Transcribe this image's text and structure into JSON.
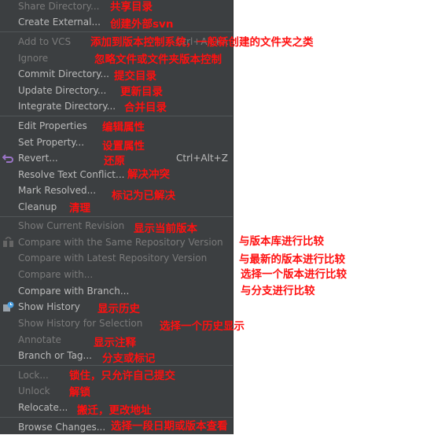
{
  "menu": {
    "items": [
      {
        "label": "Share Directory...",
        "enabled": false
      },
      {
        "label": "Create External...",
        "enabled": true
      },
      {
        "label": "Add to VCS",
        "enabled": false,
        "shortcut": "Ctrl+Alt+A"
      },
      {
        "label": "Ignore",
        "enabled": false
      },
      {
        "label": "Commit Directory...",
        "enabled": true
      },
      {
        "label": "Update Directory...",
        "enabled": true
      },
      {
        "label": "Integrate Directory...",
        "enabled": true
      },
      {
        "label": "Edit Properties",
        "enabled": true
      },
      {
        "label": "Set Property...",
        "enabled": true
      },
      {
        "label": "Revert...",
        "enabled": true,
        "shortcut": "Ctrl+Alt+Z",
        "icon": "revert-icon"
      },
      {
        "label": "Resolve Text Conflict...",
        "enabled": true
      },
      {
        "label": "Mark Resolved...",
        "enabled": true
      },
      {
        "label": "Cleanup",
        "enabled": true
      },
      {
        "label": "Show Current Revision",
        "enabled": false
      },
      {
        "label": "Compare with the Same Repository Version",
        "enabled": false,
        "icon": "compare-icon"
      },
      {
        "label": "Compare with Latest Repository Version",
        "enabled": false
      },
      {
        "label": "Compare with...",
        "enabled": false
      },
      {
        "label": "Compare with Branch...",
        "enabled": true
      },
      {
        "label": "Show History",
        "enabled": true,
        "icon": "history-icon"
      },
      {
        "label": "Show History for Selection",
        "enabled": false
      },
      {
        "label": "Annotate",
        "enabled": false
      },
      {
        "label": "Branch or Tag...",
        "enabled": true
      },
      {
        "label": "Lock...",
        "enabled": false
      },
      {
        "label": "Unlock",
        "enabled": false
      },
      {
        "label": "Relocate...",
        "enabled": true
      },
      {
        "label": "Browse Changes...",
        "enabled": true
      }
    ]
  },
  "annotations": [
    "共享目录",
    "创建外部svn",
    "添加到版本控制系统，一般新创建的文件夹之类",
    "忽略文件或文件夹版本控制",
    "提交目录",
    "更新目录",
    "合并目录",
    "编辑属性",
    "设置属性",
    "还原",
    "解决冲突",
    "标记为已解决",
    "清理",
    "显示当前版本",
    "与版本库进行比较",
    "与最新的版本进行比较",
    "选择一个版本进行比较",
    "与分支进行比较",
    "显示历史",
    "选择一个历史显示",
    "显示注释",
    "分支或标记",
    "锁住，只允许自己提交",
    "解锁",
    "搬迁，更改地址",
    "选择一段日期或版本查看"
  ],
  "colors": {
    "menu_bg": "#3c3f41",
    "text": "#bbbbbb",
    "disabled": "#7a7a7a",
    "annotation": "#ff1010"
  }
}
